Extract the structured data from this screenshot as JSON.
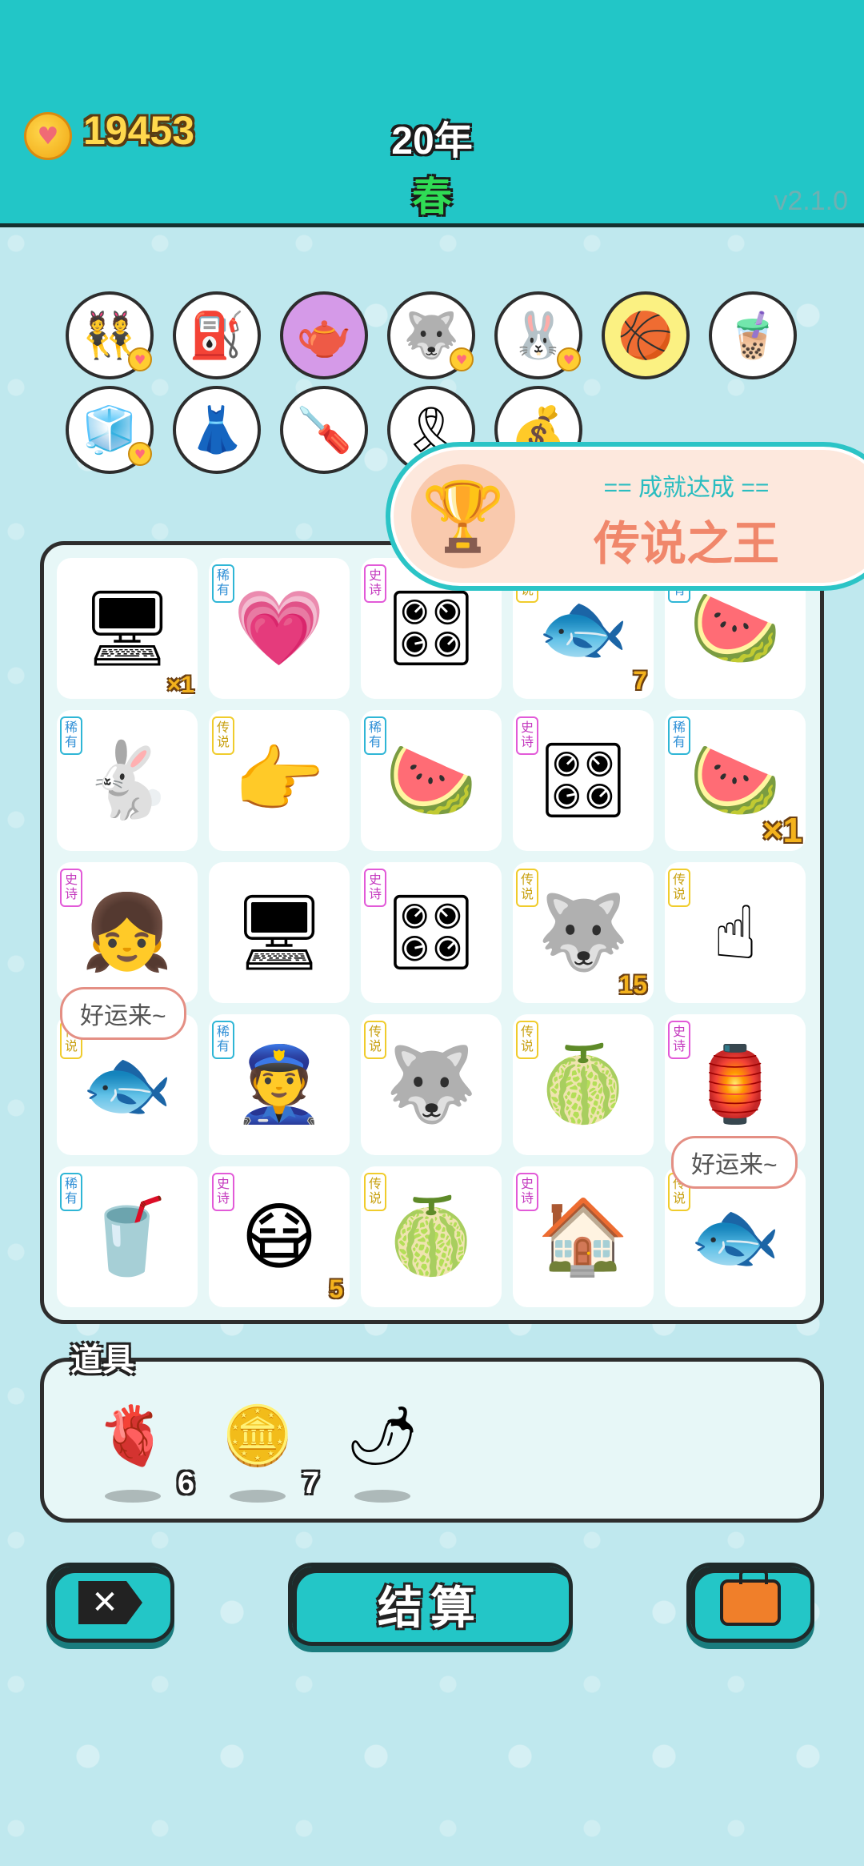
{
  "header": {
    "coins": "19453",
    "year": "20年",
    "season": "春",
    "version": "v2.1.0",
    "coin_icon": "heart-coin-icon"
  },
  "owned_items": [
    {
      "icon": "twins-icon",
      "glyph": "👯",
      "bg": "#ffffff",
      "badge": true
    },
    {
      "icon": "pump-icon",
      "glyph": "⛽",
      "bg": "#ffffff",
      "badge": false
    },
    {
      "icon": "gravy-boat-icon",
      "glyph": "🫖",
      "bg": "#d59ae8",
      "badge": false
    },
    {
      "icon": "husky-cat-icon",
      "glyph": "🐺",
      "bg": "#ffffff",
      "badge": true
    },
    {
      "icon": "rabbit-icon",
      "glyph": "🐰",
      "bg": "#ffffff",
      "badge": true
    },
    {
      "icon": "basketballs-icon",
      "glyph": "🏀",
      "bg": "#fbf182",
      "badge": false
    },
    {
      "icon": "milk-tea-icon",
      "glyph": "🧋",
      "bg": "#ffffff",
      "badge": false
    },
    {
      "icon": "sugar-cubes-icon",
      "glyph": "🧊",
      "bg": "#ffffff",
      "badge": true
    },
    {
      "icon": "skirt-icon",
      "glyph": "👗",
      "bg": "#ffffff",
      "badge": false
    },
    {
      "icon": "screwdriver-icon",
      "glyph": "🪛",
      "bg": "#ffffff",
      "badge": false
    },
    {
      "icon": "ribbon-icon",
      "glyph": "🎗",
      "bg": "#ffffff",
      "badge": false
    },
    {
      "icon": "money-bag-icon",
      "glyph": "💰",
      "bg": "#ffffff",
      "badge": false
    }
  ],
  "achievement": {
    "subtitle": "== 成就达成 ==",
    "title": "传说之王",
    "icon": "trophy-icon"
  },
  "tags": {
    "rare": "稀有",
    "epic": "史诗",
    "legend": "传说"
  },
  "board": [
    {
      "icon": "monitor-broken-icon",
      "glyph": "🖥",
      "tag": "",
      "count": "",
      "mult": "×1"
    },
    {
      "icon": "heart-icon",
      "glyph": "💗",
      "tag": "稀有",
      "count": "",
      "mult": ""
    },
    {
      "icon": "gpu-icon",
      "glyph": "🎛",
      "tag": "史诗",
      "count": "",
      "mult": ""
    },
    {
      "icon": "koi-icon",
      "glyph": "🐟",
      "tag": "传说",
      "count": "7",
      "mult": ""
    },
    {
      "icon": "watermelon-slice-icon",
      "glyph": "🍉",
      "tag": "稀有",
      "count": "",
      "mult": ""
    },
    {
      "icon": "rabbit-icon",
      "glyph": "🐇",
      "tag": "稀有",
      "count": "",
      "mult": ""
    },
    {
      "icon": "pointing-hand-icon",
      "glyph": "👉",
      "tag": "传说",
      "count": "",
      "mult": ""
    },
    {
      "icon": "watermelon-slice-icon",
      "glyph": "🍉",
      "tag": "稀有",
      "count": "",
      "mult": ""
    },
    {
      "icon": "gpu-icon",
      "glyph": "🎛",
      "tag": "史诗",
      "count": "",
      "mult": ""
    },
    {
      "icon": "watermelon-slice-icon",
      "glyph": "🍉",
      "tag": "稀有",
      "count": "",
      "mult": "×1",
      "big": true
    },
    {
      "icon": "girl-icon",
      "glyph": "👧",
      "tag": "史诗",
      "count": "",
      "mult": ""
    },
    {
      "icon": "monitor-icon",
      "glyph": "🖥",
      "tag": "",
      "count": "",
      "mult": ""
    },
    {
      "icon": "gpu-icon",
      "glyph": "🎛",
      "tag": "史诗",
      "count": "",
      "mult": ""
    },
    {
      "icon": "husky-king-icon",
      "glyph": "🐺",
      "tag": "传说",
      "count": "15",
      "mult": ""
    },
    {
      "icon": "finger-up-icon",
      "glyph": "☝",
      "tag": "传说",
      "count": "",
      "mult": ""
    },
    {
      "icon": "koi-icon",
      "glyph": "🐟",
      "tag": "传说",
      "count": "",
      "mult": ""
    },
    {
      "icon": "police-icon",
      "glyph": "👮",
      "tag": "稀有",
      "count": "",
      "mult": ""
    },
    {
      "icon": "husky-king-icon",
      "glyph": "🐺",
      "tag": "传说",
      "count": "",
      "mult": ""
    },
    {
      "icon": "watermelon-icon",
      "glyph": "🍈",
      "tag": "传说",
      "count": "",
      "mult": ""
    },
    {
      "icon": "rabbit-house-icon",
      "glyph": "🏮",
      "tag": "史诗",
      "count": "",
      "mult": ""
    },
    {
      "icon": "milk-tea-icon",
      "glyph": "🥤",
      "tag": "稀有",
      "count": "",
      "mult": ""
    },
    {
      "icon": "masked-man-icon",
      "glyph": "😷",
      "tag": "史诗",
      "count": "5",
      "mult": ""
    },
    {
      "icon": "watermelon-icon",
      "glyph": "🍈",
      "tag": "传说",
      "count": "",
      "mult": ""
    },
    {
      "icon": "haunted-house-icon",
      "glyph": "🏠",
      "tag": "史诗",
      "count": "",
      "mult": ""
    },
    {
      "icon": "koi-icon",
      "glyph": "🐟",
      "tag": "传说",
      "count": "",
      "mult": ""
    }
  ],
  "bubbles": [
    "好运来~",
    "好运来~"
  ],
  "props": {
    "title": "道具",
    "items": [
      {
        "icon": "liver-icon",
        "glyph": "🫀",
        "count": "6"
      },
      {
        "icon": "dollar-coin-icon",
        "glyph": "🪙",
        "count": "7"
      },
      {
        "icon": "chili-icon",
        "glyph": "🌶",
        "count": ""
      }
    ]
  },
  "buttons": {
    "close_icon": "close-tag-icon",
    "settle_label": "结算",
    "bag_icon": "briefcase-icon"
  },
  "colors": {
    "header": "#22c6c7",
    "background": "#bfe8ee",
    "accent_gold": "#ffd84d"
  }
}
